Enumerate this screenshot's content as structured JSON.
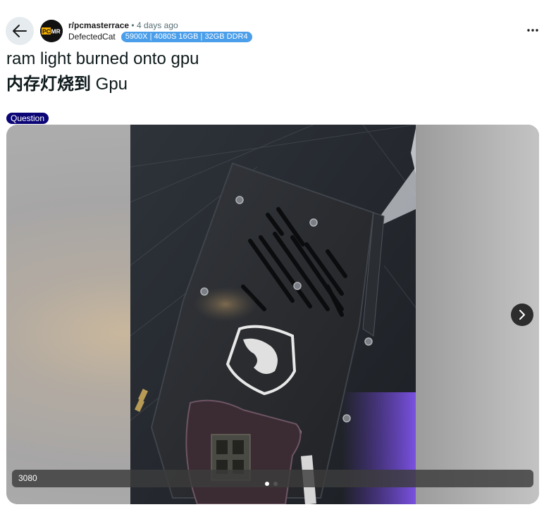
{
  "header": {
    "back_icon": "arrow-left-icon",
    "subreddit": "r/pcmasterrace",
    "separator": "•",
    "time_ago": "4 days ago",
    "avatar_text": "PCMR",
    "username": "DefectedCat",
    "user_flair": "5900X | 4080S 16GB | 32GB DDR4",
    "more_icon": "ellipsis-icon"
  },
  "post": {
    "title_line1": "ram light burned onto gpu",
    "title_line2_cjk": "内存灯烧到",
    "title_line2_latin": " Gpu",
    "flair": "Question",
    "flair_color": "#0b0575"
  },
  "gallery": {
    "caption": "3080",
    "next_icon": "chevron-right-icon",
    "pages": 2,
    "current_page": 1
  }
}
